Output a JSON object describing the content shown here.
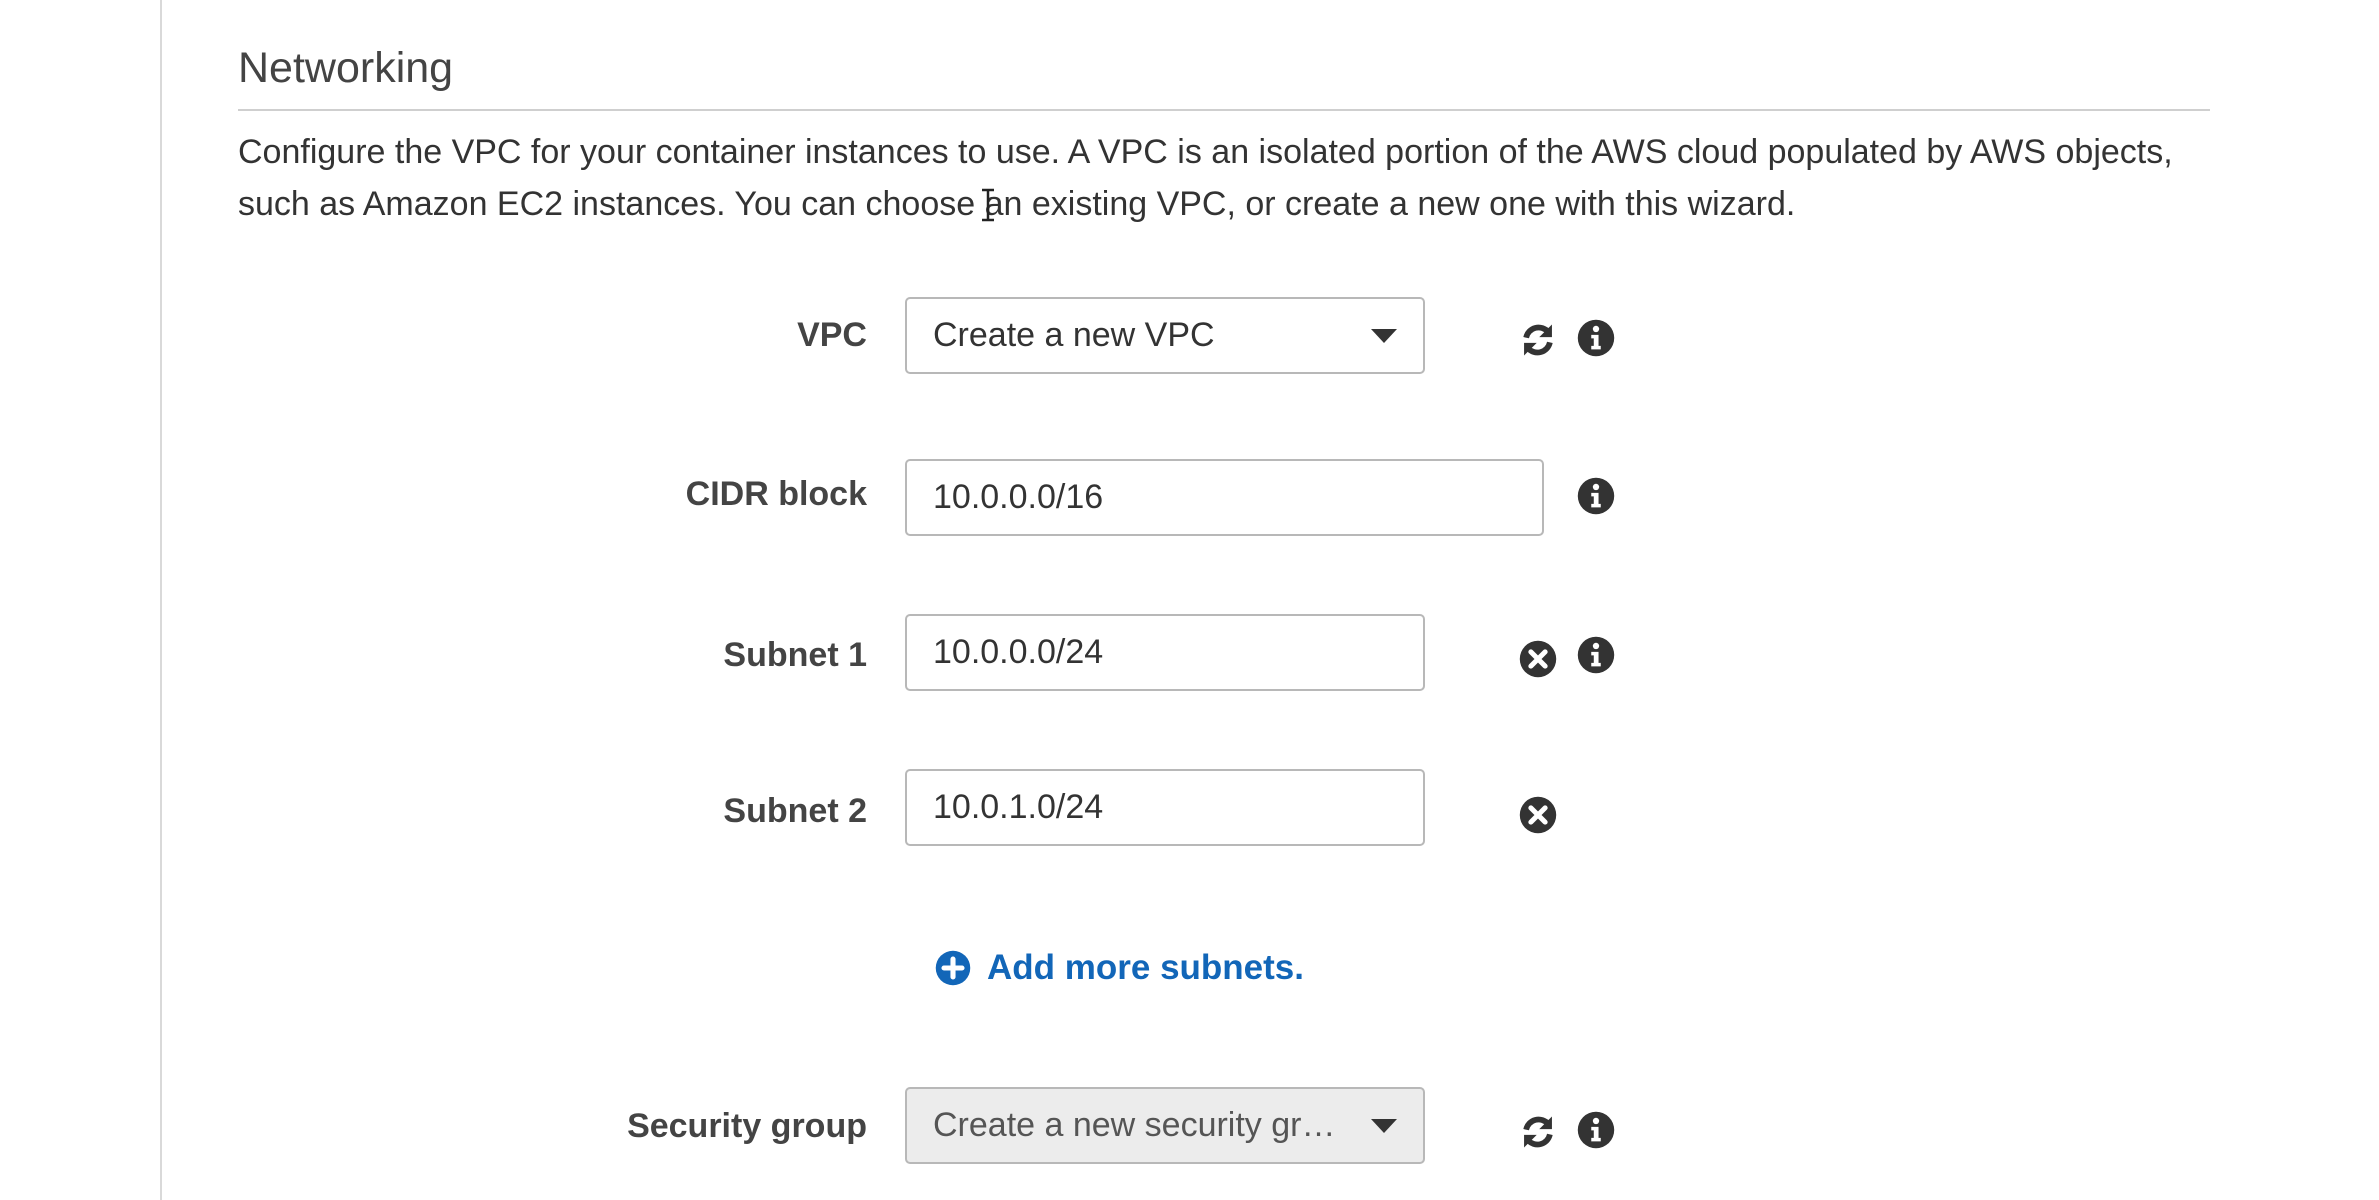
{
  "section": {
    "title": "Networking",
    "description": "Configure the VPC for your container instances to use. A VPC is an isolated portion of the AWS cloud populated by AWS objects, such as Amazon EC2 instances. You can choose an existing VPC, or create a new one with this wizard."
  },
  "form": {
    "vpc": {
      "label": "VPC",
      "selected": "Create a new VPC",
      "icons": [
        "refresh-icon",
        "info-icon"
      ]
    },
    "cidr": {
      "label": "CIDR block",
      "value": "10.0.0.0/16",
      "icons": [
        "info-icon"
      ]
    },
    "subnet1": {
      "label": "Subnet 1",
      "value": "10.0.0.0/24",
      "icons": [
        "remove-icon",
        "info-icon"
      ]
    },
    "subnet2": {
      "label": "Subnet 2",
      "value": "10.0.1.0/24",
      "icons": [
        "remove-icon"
      ]
    },
    "add_subnets": {
      "label": "Add more subnets.",
      "icon": "plus-circle-icon"
    },
    "security_group": {
      "label": "Security group",
      "selected": "Create a new security gr…",
      "disabled": true,
      "icons": [
        "refresh-icon",
        "info-icon"
      ]
    }
  },
  "colors": {
    "link": "#1266b8",
    "icon": "#333333",
    "label": "#444444",
    "border": "#b8b8b8",
    "disabled_bg": "#ececec"
  }
}
